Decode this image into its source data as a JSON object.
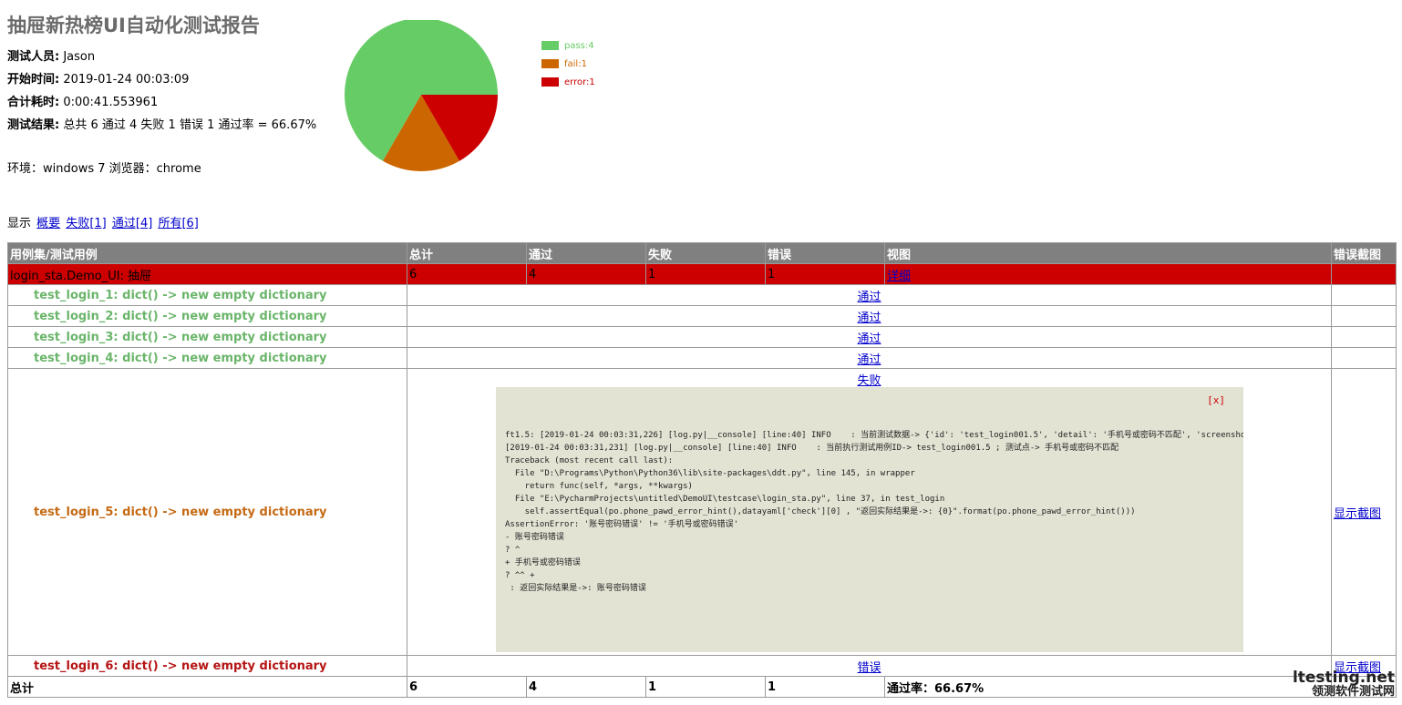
{
  "report": {
    "title": "抽屉新热榜UI自动化测试报告",
    "attributes": [
      {
        "label": "测试人员:",
        "value": "Jason"
      },
      {
        "label": "开始时间:",
        "value": "2019-01-24 00:03:09"
      },
      {
        "label": "合计耗时:",
        "value": "0:00:41.553961"
      },
      {
        "label": "测试结果:",
        "value": "总共 6 通过 4 失败 1 错误 1 通过率 = 66.67%"
      }
    ],
    "environment": "环境：windows 7 浏览器：chrome"
  },
  "chart_data": {
    "type": "pie",
    "slices": [
      {
        "label": "pass:4",
        "value": 4,
        "color": "#66cc66"
      },
      {
        "label": "fail:1",
        "value": 1,
        "color": "#cc6600"
      },
      {
        "label": "error:1",
        "value": 1,
        "color": "#cc0000"
      }
    ]
  },
  "filter": {
    "prefix": "显示",
    "links": [
      "概要",
      "失败[1]",
      "通过[4]",
      "所有[6]"
    ]
  },
  "table": {
    "headers": [
      "用例集/测试用例",
      "总计",
      "通过",
      "失败",
      "错误",
      "视图",
      "错误截图"
    ],
    "suite": {
      "name": "login_sta.Demo_UI: 抽屉",
      "total": "6",
      "pass": "4",
      "fail": "1",
      "error": "1",
      "view": "详细"
    },
    "cases": [
      {
        "name": "test_login_1: dict() -> new empty dictionary",
        "status": "通过",
        "screenshot": ""
      },
      {
        "name": "test_login_2: dict() -> new empty dictionary",
        "status": "通过",
        "screenshot": ""
      },
      {
        "name": "test_login_3: dict() -> new empty dictionary",
        "status": "通过",
        "screenshot": ""
      },
      {
        "name": "test_login_4: dict() -> new empty dictionary",
        "status": "通过",
        "screenshot": ""
      },
      {
        "name": "test_login_5: dict() -> new empty dictionary",
        "status": "失败",
        "screenshot": "显示截图"
      },
      {
        "name": "test_login_6: dict() -> new empty dictionary",
        "status": "错误",
        "screenshot": "显示截图"
      }
    ],
    "popup": {
      "close": "[x]",
      "log": "ft1.5: [2019-01-24 00:03:31,226] [log.py|__console] [line:40] INFO    : 当前测试数据-> {'id': 'test_login001.5', 'detail': '手机号或密码不匹配', 'screenshot': 'phone_pawd_error', 'data'\n[2019-01-24 00:03:31,231] [log.py|__console] [line:40] INFO    : 当前执行测试用例ID-> test_login001.5 ; 测试点-> 手机号或密码不匹配\nTraceback (most recent call last):\n  File \"D:\\Programs\\Python\\Python36\\lib\\site-packages\\ddt.py\", line 145, in wrapper\n    return func(self, *args, **kwargs)\n  File \"E:\\PycharmProjects\\untitled\\DemoUI\\testcase\\login_sta.py\", line 37, in test_login\n    self.assertEqual(po.phone_pawd_error_hint(),datayaml['check'][0] , \"返回实际结果是->: {0}\".format(po.phone_pawd_error_hint()))\nAssertionError: '账号密码错误' != '手机号或密码错误'\n- 账号密码错误\n? ^\n+ 手机号或密码错误\n? ^^ +\n : 返回实际结果是->: 账号密码错误"
    },
    "total": {
      "label": "总计",
      "total": "6",
      "pass": "4",
      "fail": "1",
      "error": "1",
      "rate": "通过率：66.67%"
    }
  },
  "watermark": {
    "line1": "ltesting.net",
    "line2": "领测软件测试网"
  }
}
